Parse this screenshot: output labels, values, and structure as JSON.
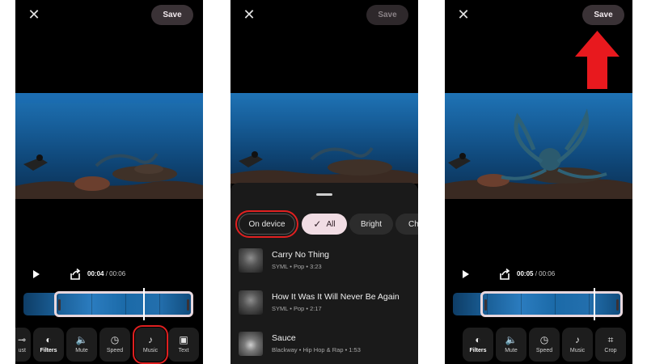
{
  "panels": [
    {
      "save_label": "Save",
      "time": {
        "current": "00:04",
        "separator": " / ",
        "duration": "00:06"
      },
      "tools": [
        {
          "label": "ust",
          "icon": "adjust-icon"
        },
        {
          "label": "Filters",
          "icon": "filters-icon"
        },
        {
          "label": "Mute",
          "icon": "volume-icon"
        },
        {
          "label": "Speed",
          "icon": "speed-icon"
        },
        {
          "label": "Music",
          "icon": "music-note-icon"
        },
        {
          "label": "Text",
          "icon": "text-box-icon"
        }
      ]
    },
    {
      "save_label": "Save",
      "chips": [
        {
          "label": "On device"
        },
        {
          "label": "All",
          "selected": true
        },
        {
          "label": "Bright"
        },
        {
          "label": "Ch"
        }
      ],
      "tracks": [
        {
          "title": "Carry No Thing",
          "meta": "SYML • Pop • 3:23"
        },
        {
          "title": "How It Was It Will Never Be Again",
          "meta": "SYML • Pop • 2:17"
        },
        {
          "title": "Sauce",
          "meta": "Blackway • Hip Hop & Rap • 1:53"
        }
      ]
    },
    {
      "save_label": "Save",
      "time": {
        "current": "00:05",
        "separator": " / ",
        "duration": "00:06"
      },
      "tools": [
        {
          "label": "Filters",
          "icon": "filters-icon"
        },
        {
          "label": "Mute",
          "icon": "volume-icon"
        },
        {
          "label": "Speed",
          "icon": "speed-icon"
        },
        {
          "label": "Music",
          "icon": "music-note-icon"
        },
        {
          "label": "Crop",
          "icon": "crop-icon"
        }
      ]
    }
  ],
  "colors": {
    "highlight": "#e02020",
    "arrow": "#e8191e",
    "chip_selected": "#f1dde4"
  }
}
